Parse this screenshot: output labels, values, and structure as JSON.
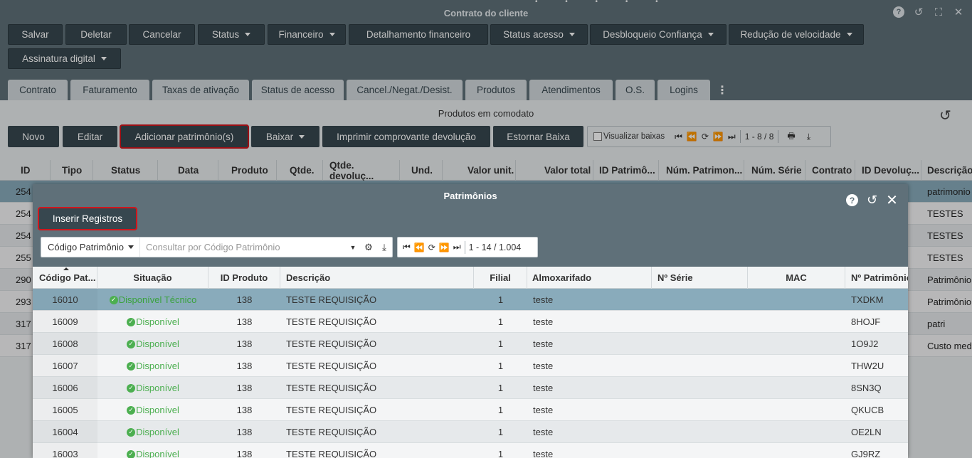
{
  "window": {
    "title": "Contrato do cliente",
    "icons": [
      "help-icon",
      "history-icon",
      "fullscreen-icon",
      "close-icon"
    ]
  },
  "toolbar": {
    "salvar": "Salvar",
    "deletar": "Deletar",
    "cancelar": "Cancelar",
    "status": "Status",
    "financeiro": "Financeiro",
    "detalhamento": "Detalhamento financeiro",
    "status_acesso": "Status acesso",
    "desbloqueio": "Desbloqueio Confiança",
    "reducao": "Redução de velocidade",
    "assinatura": "Assinatura digital"
  },
  "tabs": [
    "Contrato",
    "Faturamento",
    "Taxas de ativação",
    "Status de acesso",
    "Cancel./Negat./Desist.",
    "Produtos",
    "Atendimentos",
    "O.S.",
    "Logins"
  ],
  "section": {
    "title": "Produtos em comodato",
    "novo": "Novo",
    "editar": "Editar",
    "adicionar": "Adicionar patrimônio(s)",
    "baixar": "Baixar",
    "imprimir": "Imprimir comprovante devolução",
    "estornar": "Estornar Baixa",
    "visualizar": "Visualizar baixas",
    "pager": "1 - 8 / 8"
  },
  "main_grid": {
    "columns": [
      "ID",
      "Tipo",
      "Status",
      "Data",
      "Produto",
      "Qtde.",
      "Qtde. devoluç...",
      "Und.",
      "Valor unit.",
      "Valor total",
      "ID Patrimô...",
      "Núm. Patrimon...",
      "Núm. Série",
      "Contrato",
      "ID Devoluç...",
      "Descrição p"
    ],
    "rows": [
      {
        "id": "254",
        "desc": "patrimonio"
      },
      {
        "id": "254",
        "desc": "TESTES"
      },
      {
        "id": "254",
        "desc": "TESTES"
      },
      {
        "id": "255",
        "desc": "TESTES"
      },
      {
        "id": "290",
        "desc": "Patrimônio"
      },
      {
        "id": "293",
        "desc": "Patrimônio"
      },
      {
        "id": "317",
        "desc": "patri"
      },
      {
        "id": "317",
        "desc": "Custo medi"
      }
    ]
  },
  "modal": {
    "title": "Patrimônios",
    "insert_button": "Inserir Registros",
    "search_field": "Código Patrimônio",
    "search_placeholder": "Consultar por Código Patrimônio",
    "pager": "1 - 14 / 1.004",
    "columns": [
      "Código Pat...",
      "Situação",
      "ID Produto",
      "Descrição",
      "Filial",
      "Almoxarifado",
      "Nº Série",
      "MAC",
      "Nº Patrimônio"
    ],
    "rows": [
      {
        "codigo": "16010",
        "situacao": "Disponível Técnico",
        "id_produto": "138",
        "descricao": "TESTE REQUISIÇÃO",
        "filial": "1",
        "almox": "teste",
        "serie": "",
        "mac": "",
        "patrimonio": "TXDKM"
      },
      {
        "codigo": "16009",
        "situacao": "Disponível",
        "id_produto": "138",
        "descricao": "TESTE REQUISIÇÃO",
        "filial": "1",
        "almox": "teste",
        "serie": "",
        "mac": "",
        "patrimonio": "8HOJF"
      },
      {
        "codigo": "16008",
        "situacao": "Disponível",
        "id_produto": "138",
        "descricao": "TESTE REQUISIÇÃO",
        "filial": "1",
        "almox": "teste",
        "serie": "",
        "mac": "",
        "patrimonio": "1O9J2"
      },
      {
        "codigo": "16007",
        "situacao": "Disponível",
        "id_produto": "138",
        "descricao": "TESTE REQUISIÇÃO",
        "filial": "1",
        "almox": "teste",
        "serie": "",
        "mac": "",
        "patrimonio": "THW2U"
      },
      {
        "codigo": "16006",
        "situacao": "Disponível",
        "id_produto": "138",
        "descricao": "TESTE REQUISIÇÃO",
        "filial": "1",
        "almox": "teste",
        "serie": "",
        "mac": "",
        "patrimonio": "8SN3Q"
      },
      {
        "codigo": "16005",
        "situacao": "Disponível",
        "id_produto": "138",
        "descricao": "TESTE REQUISIÇÃO",
        "filial": "1",
        "almox": "teste",
        "serie": "",
        "mac": "",
        "patrimonio": "QKUCB"
      },
      {
        "codigo": "16004",
        "situacao": "Disponível",
        "id_produto": "138",
        "descricao": "TESTE REQUISIÇÃO",
        "filial": "1",
        "almox": "teste",
        "serie": "",
        "mac": "",
        "patrimonio": "OE2LN"
      },
      {
        "codigo": "16003",
        "situacao": "Disponível",
        "id_produto": "138",
        "descricao": "TESTE REQUISIÇÃO",
        "filial": "1",
        "almox": "teste",
        "serie": "",
        "mac": "",
        "patrimonio": "GJ9RZ"
      }
    ]
  },
  "colors": {
    "header_bg": "#5f7079",
    "button_bg": "#37474f",
    "highlight_outline": "#d0161c",
    "selected_row": "#89abbb",
    "status_green": "#4caf50"
  }
}
